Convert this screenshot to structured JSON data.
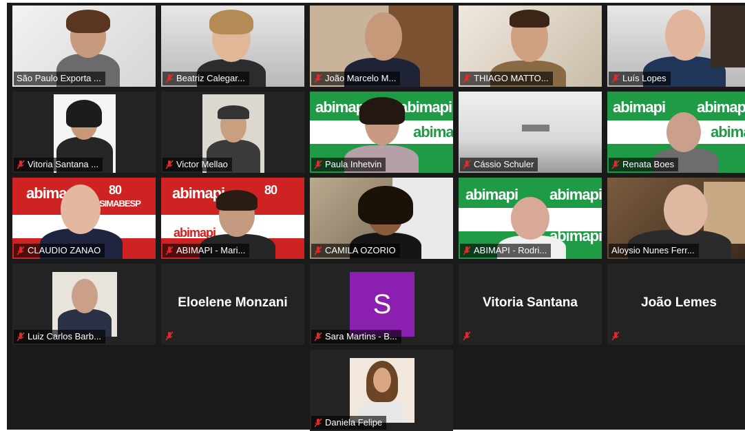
{
  "participants": [
    {
      "name": "São Paulo Exporta ...",
      "muted": false
    },
    {
      "name": "Beatriz Calegar...",
      "muted": true
    },
    {
      "name": "João Marcelo M...",
      "muted": true
    },
    {
      "name": "THIAGO MATTO...",
      "muted": true
    },
    {
      "name": "Luís Lopes",
      "muted": true
    },
    {
      "name": "Vitoria Santana ...",
      "muted": true
    },
    {
      "name": "Victor Mellao",
      "muted": true
    },
    {
      "name": "Paula Inhetvin",
      "muted": true
    },
    {
      "name": "Cássio Schuler",
      "muted": true
    },
    {
      "name": "Renata Boes",
      "muted": true
    },
    {
      "name": "CLAUDIO ZANAO",
      "muted": true
    },
    {
      "name": "ABIMAPI - Mari...",
      "muted": true
    },
    {
      "name": "CAMILA OZORIO",
      "muted": true
    },
    {
      "name": "ABIMAPI - Rodri...",
      "muted": true
    },
    {
      "name": "Aloysio Nunes Ferr...",
      "muted": false,
      "active_speaker": true
    },
    {
      "name": "Luiz Carlos Barb...",
      "muted": true
    },
    {
      "name": "Eloelene Monzani",
      "muted": true,
      "video": false
    },
    {
      "name": "Sara Martins - B...",
      "muted": true,
      "avatar_letter": "S"
    },
    {
      "name": "Vitoria Santana",
      "muted": true,
      "video": false
    },
    {
      "name": "João Lemes",
      "muted": true,
      "video": false
    },
    {
      "name": "Daniela Felipe",
      "muted": true
    }
  ],
  "brand": {
    "abimapi": "abimapi",
    "simabesp": "SIMABESP",
    "simabesp_years": "80"
  },
  "colors": {
    "active_border": "#c6e64a",
    "muted_icon": "#e02b2b",
    "abimapi_green": "#1f9b45",
    "simabesp_red": "#cf2222",
    "avatar_purple": "#8a1fb0"
  }
}
